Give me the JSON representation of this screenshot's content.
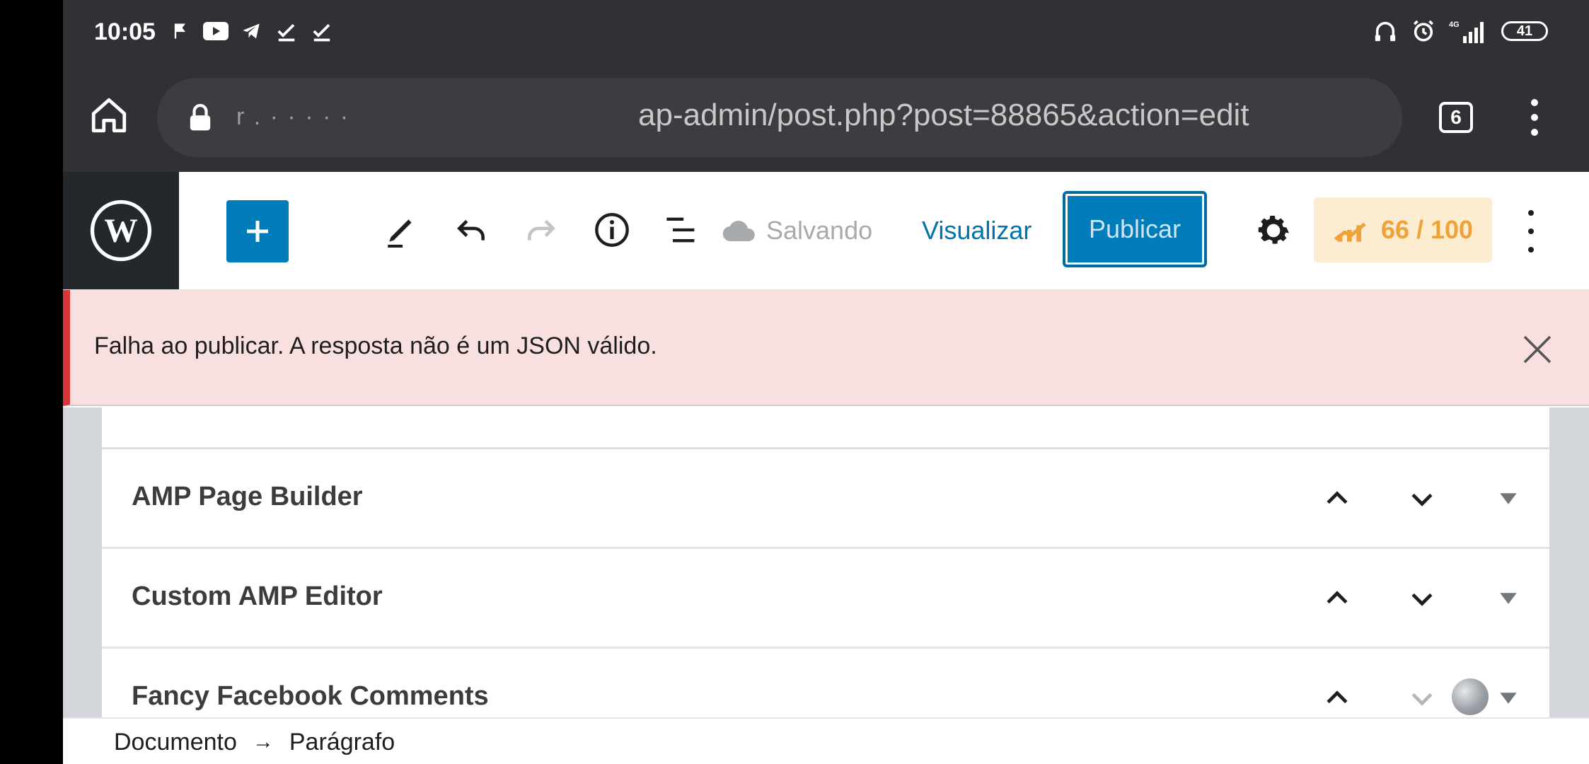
{
  "status_bar": {
    "time": "10:05",
    "network": "4G",
    "battery": "41"
  },
  "browser": {
    "url_masked": "r  .  ·  ·  ·  ·  ·",
    "url_visible": "ap-admin/post.php?post=88865&action=edit",
    "tab_count": "6"
  },
  "toolbar": {
    "saving_label": "Salvando",
    "preview_label": "Visualizar",
    "publish_label": "Publicar",
    "seo_score": "66 / 100"
  },
  "notice": {
    "message": "Falha ao publicar. A resposta não é um JSON válido."
  },
  "metaboxes": [
    {
      "title": "AMP Page Builder"
    },
    {
      "title": "Custom AMP Editor"
    },
    {
      "title": "Fancy Facebook Comments"
    }
  ],
  "breadcrumb": {
    "items": [
      "Documento",
      "Parágrafo"
    ],
    "separator": "→"
  },
  "colors": {
    "accent": "#007cba",
    "error": "#d63638",
    "notice_bg": "#f8e0e0",
    "seo_bg": "#fdedd0",
    "seo_text": "#f0a23a"
  }
}
